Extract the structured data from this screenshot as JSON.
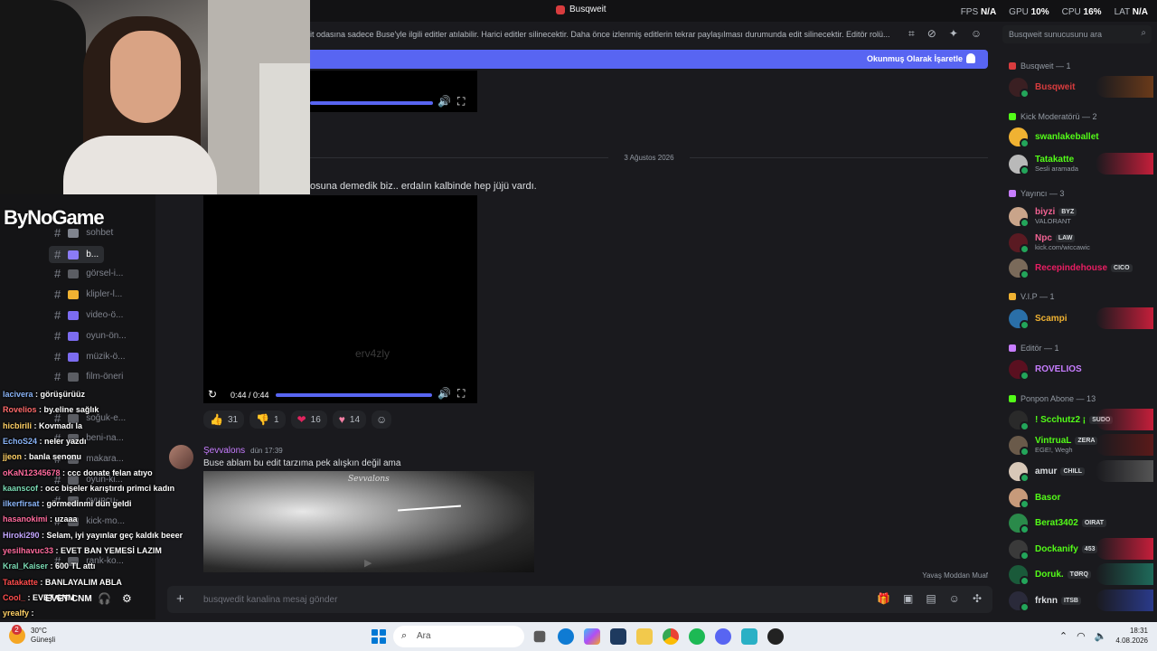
{
  "window": {
    "title": "Busqweit"
  },
  "stats": [
    {
      "label": "FPS",
      "value": "N/A"
    },
    {
      "label": "GPU",
      "value": "10%"
    },
    {
      "label": "CPU",
      "value": "16%"
    },
    {
      "label": "LAT",
      "value": "N/A"
    }
  ],
  "announcement": "it odasına sadece Buse'yle ilgili editler atılabilir. Harici editler silinecektir. Daha önce izlenmiş editlerin tekrar paylaşılması durumunda edit silinecektir. Editör rolü...",
  "search_placeholder": "Busqweit sunucusunu ara",
  "unread_label": "Okunmuş Olarak İşaretle",
  "video1": {
    "progress": 1.0
  },
  "date_divider": "3 Ağustos 2026",
  "message1_text": "osuna demedik biz.. erdalın kalbinde hep jüjü vardı.",
  "video2": {
    "watermark": "erv4zly",
    "time": "0:44 / 0:44",
    "progress": 1.0
  },
  "reactions": [
    {
      "emoji": "👍",
      "count": "31",
      "color": "#f5c542"
    },
    {
      "emoji": "👎",
      "count": "1",
      "color": "#f5c542"
    },
    {
      "emoji": "❤",
      "count": "16",
      "color": "#e0245e"
    },
    {
      "emoji": "♥",
      "count": "14",
      "color": "#f47fa4"
    }
  ],
  "message2": {
    "author": "Şevvalons",
    "timestamp": "dün 17:39",
    "text": "Buse ablam bu edit tarzıma pek alışkın değil ama",
    "image_caption": "Sevvalons"
  },
  "slow_mode": "Yavaş Moddan Muaf",
  "composer_placeholder": "busqwedit kanalina mesaj gönder",
  "brand_logo": "ByNoGame",
  "channels": [
    {
      "label": "sohbet",
      "color": "#80848e"
    },
    {
      "label": "b...",
      "color": "#8b7cf6",
      "active": true
    },
    {
      "label": "görsel-i...",
      "color": "#5b5d63"
    },
    {
      "label": "klipler-l...",
      "color": "#f0b232"
    },
    {
      "label": "video-ö...",
      "color": "#7c6cf0"
    },
    {
      "label": "oyun-ön...",
      "color": "#7c6cf0"
    },
    {
      "label": "müzik-ö...",
      "color": "#7c6cf0"
    },
    {
      "label": "film-öneri",
      "color": "#5b5d63"
    },
    {
      "label": "soğuk-e...",
      "color": "#5b5d63"
    },
    {
      "label": "beni-na...",
      "color": "#5b5d63"
    },
    {
      "label": "makara...",
      "color": "#5b5d63"
    },
    {
      "label": "oyun-ki...",
      "color": "#5b5d63"
    },
    {
      "label": "oyuncu-...",
      "color": "#5b5d63"
    },
    {
      "label": "kick-mo...",
      "color": "#5b5d63"
    },
    {
      "label": "rank-ko...",
      "color": "#5b5d63"
    }
  ],
  "stream_chat": [
    {
      "user": "lacivera",
      "text": "görüşürüüz",
      "color": "#8ab4f8"
    },
    {
      "user": "Rovelios",
      "text": "by.eline sağlık",
      "color": "#ff6b6b"
    },
    {
      "user": "hicbirili",
      "text": "Kovmadı la",
      "color": "#ffd166"
    },
    {
      "user": "EchoS24",
      "text": "neler yazdı",
      "color": "#8ab4f8"
    },
    {
      "user": "jjeon",
      "text": "banla senonu",
      "color": "#ffd166"
    },
    {
      "user": "oKaN12345678",
      "text": "ccc donate felan atıyo",
      "color": "#ff6b9d"
    },
    {
      "user": "kaanscof",
      "text": "occ bişeler karıştırdı primci kadın",
      "color": "#7bdcb5"
    },
    {
      "user": "ilkerfirsat",
      "text": "görmedinmi dün geldi",
      "color": "#8ab4f8"
    },
    {
      "user": "hasanokimi",
      "text": "uzaaa",
      "color": "#ff6b9d"
    },
    {
      "user": "Hiroki290",
      "text": "Selam, iyi yayınlar geç kaldık beeer",
      "color": "#c3a6ff"
    },
    {
      "user": "yesilhavuc33",
      "text": "EVET BAN YEMESİ LAZIM",
      "color": "#ff6b9d"
    },
    {
      "user": "Kral_Kaiser",
      "text": "600 TL attı",
      "color": "#7bdcb5"
    },
    {
      "user": "Tatakatte",
      "text": "BANLAYALIM ABLA",
      "color": "#ff4d4d"
    },
    {
      "user": "Cool_",
      "text": "EVET CNM",
      "color": "#ff4d4d"
    },
    {
      "user": "yrealfy",
      "text": "",
      "color": "#ffd166"
    }
  ],
  "members": {
    "groups": [
      {
        "label": "Busqweit — 1",
        "color": "#d83c3e"
      },
      {
        "label": "Kick Moderatörü — 2",
        "color": "#53fc18"
      },
      {
        "label": "Yayıncı — 3",
        "color": "#c77dff"
      },
      {
        "label": "V.I.P — 1",
        "color": "#f0b232"
      },
      {
        "label": "Editör — 1",
        "color": "#c77dff"
      },
      {
        "label": "Ponpon Abone — 13",
        "color": "#53fc18"
      }
    ],
    "list": [
      {
        "name": "Busqweit",
        "color": "#d83c3e",
        "sub": "",
        "tag": ""
      },
      {
        "name": "swanlakeballet",
        "color": "#53fc18",
        "sub": "",
        "tag": ""
      },
      {
        "name": "Tatakatte",
        "color": "#53fc18",
        "sub": "Sesli aramada",
        "tag": ""
      },
      {
        "name": "biyzi",
        "color": "#f06292",
        "sub": "VALORANT",
        "tag": "BYZ"
      },
      {
        "name": "Npc",
        "color": "#f06292",
        "sub": "kick.com/wiccawic",
        "tag": "LAW"
      },
      {
        "name": "Recepindehouse",
        "color": "#e91e63",
        "sub": "",
        "tag": "CICO"
      },
      {
        "name": "Scampi",
        "color": "#f0b232",
        "sub": "",
        "tag": ""
      },
      {
        "name": "ROVELIOS",
        "color": "#c77dff",
        "sub": "",
        "tag": ""
      },
      {
        "name": "! Scchutz2 ¡",
        "color": "#53fc18",
        "sub": "",
        "tag": "SUDO"
      },
      {
        "name": "VintruaL",
        "color": "#53fc18",
        "sub": "EGE!, Wegh",
        "tag": "ZERA"
      },
      {
        "name": "amur",
        "color": "#dbdee1",
        "sub": "",
        "tag": "CHILL"
      },
      {
        "name": "Basor",
        "color": "#53fc18",
        "sub": "",
        "tag": ""
      },
      {
        "name": "Berat3402",
        "color": "#53fc18",
        "sub": "",
        "tag": "OIRAT"
      },
      {
        "name": "Dockanify",
        "color": "#53fc18",
        "sub": "",
        "tag": "453"
      },
      {
        "name": "Doruk.",
        "color": "#53fc18",
        "sub": "",
        "tag": "TØRQ"
      },
      {
        "name": "frknn",
        "color": "#dbdee1",
        "sub": "",
        "tag": "ITSB"
      }
    ]
  },
  "user_panel": {
    "name": "EVET CNM"
  },
  "taskbar": {
    "weather_temp": "30°C",
    "weather_desc": "Güneşli",
    "weather_badge": "2",
    "search_placeholder": "Ara",
    "time": "18:31",
    "date": "4.08.2026"
  }
}
